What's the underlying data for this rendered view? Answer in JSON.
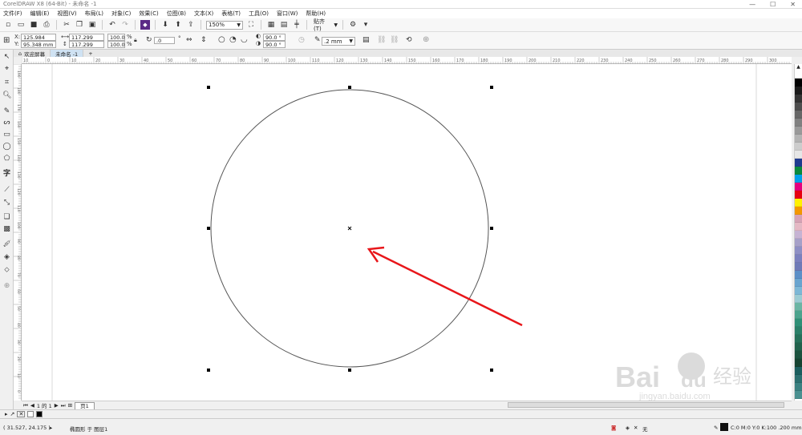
{
  "window": {
    "title": "CorelDRAW X8 (64-Bit) - 未命名 -1",
    "controls": [
      "—",
      "☐",
      "✕"
    ]
  },
  "menu": [
    "文件(F)",
    "编辑(E)",
    "视图(V)",
    "布局(L)",
    "对象(C)",
    "效果(C)",
    "位图(B)",
    "文本(X)",
    "表格(T)",
    "工具(O)",
    "窗口(W)",
    "帮助(H)"
  ],
  "toolbar": {
    "zoom_value": "150%",
    "snap_label": "贴齐(T)"
  },
  "property_bar": {
    "x_label": "X:",
    "x_value": "125.984 mm",
    "y_label": "Y:",
    "y_value": "95.348 mm",
    "width_value": "117.299 mm",
    "height_value": "117.299 mm",
    "scale_w": "100.0",
    "scale_h": "100.0",
    "percent": "%",
    "rotation_value": ".0",
    "start_angle": "90.0 °",
    "end_angle": "90.0 °",
    "outline_width": ".2 mm"
  },
  "tabs": {
    "welcome": "欢迎屏幕",
    "document": "未命名 -1",
    "add": "+"
  },
  "ruler_ticks": [
    "10",
    "0",
    "10",
    "20",
    "30",
    "40",
    "50",
    "60",
    "70",
    "80",
    "90",
    "100",
    "110",
    "120",
    "130",
    "140",
    "150",
    "160",
    "170",
    "180",
    "190",
    "200",
    "210",
    "220",
    "230",
    "240",
    "250",
    "260",
    "270",
    "280",
    "290",
    "300"
  ],
  "vruler_ticks": [
    "190",
    "180",
    "170",
    "160",
    "150",
    "140",
    "130",
    "120",
    "110",
    "100",
    "90",
    "80",
    "70",
    "60",
    "50",
    "40",
    "30",
    "20",
    "10",
    "0"
  ],
  "page_nav": {
    "page_info": "1 的 1",
    "page_tab": "页1"
  },
  "palette_colors": [
    "#ffffff",
    "#000000",
    "#1a1a1a",
    "#333333",
    "#4d4d4d",
    "#666666",
    "#808080",
    "#999999",
    "#b3b3b3",
    "#cccccc",
    "#e6e6e6",
    "#1f3b8f",
    "#0a8a3c",
    "#00a0e9",
    "#e4007f",
    "#e60012",
    "#fff100",
    "#f39800",
    "#d6a3b6",
    "#e4b8c4",
    "#c6b3d3",
    "#a6a0c8",
    "#8e8fc4",
    "#7b80be",
    "#6f7ab7",
    "#5c8fc7",
    "#69a4cf",
    "#7db7d6",
    "#9ccbd3",
    "#6cb5a4",
    "#4ca38d",
    "#2f8f76",
    "#2a7f68",
    "#257059",
    "#20614b",
    "#1b523e",
    "#154331",
    "#1b5e5e",
    "#2b6f6f",
    "#3a8080",
    "#4a9090"
  ],
  "colorbar": {
    "no_color": "✕"
  },
  "status": {
    "cursor_pos": "( 31.527, 24.175 )",
    "arrow": "▸",
    "object_info": "椭圆形 于 图层1",
    "fill_label": "无",
    "outline_info": "C:0 M:0 Y:0 K:100 .200 mm"
  },
  "watermark": {
    "brand": "Bai",
    "brand2": "du",
    "cn": "经验",
    "url": "jingyan.baidu.com"
  }
}
